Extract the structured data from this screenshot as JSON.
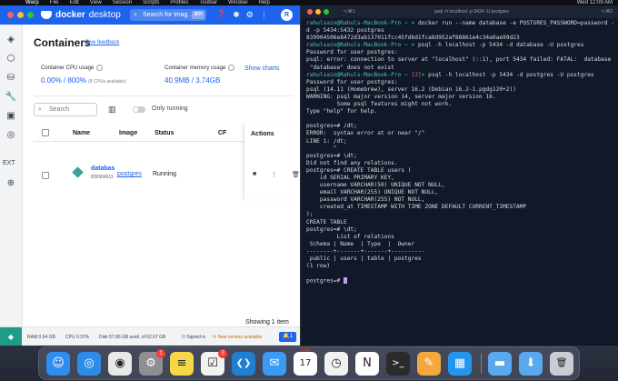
{
  "menubar": {
    "apple": "",
    "items": [
      "Warp",
      "File",
      "Edit",
      "View",
      "Session",
      "Scripts",
      "Profiles",
      "Toolbar",
      "Window",
      "Help"
    ],
    "time": "Wed 12:09 AM"
  },
  "docker": {
    "brand_bold": "docker",
    "brand_light": "desktop",
    "search_placeholder": "Search for imag...",
    "search_shortcut": "⌘K",
    "avatar_initial": "R",
    "page_title": "Containers",
    "feedback_link": "Give feedback",
    "cpu_label": "Container CPU usage",
    "cpu_value": "0.00% / 800%",
    "cpu_sub": "(8 CPUs available)",
    "mem_label": "Container memory usage",
    "mem_value": "40.9MB / 3.74GB",
    "show_charts": "Show charts",
    "search_input_placeholder": "Search",
    "only_running": "Only running",
    "columns": {
      "name": "Name",
      "image": "Image",
      "status": "Status",
      "cpu": "CF",
      "actions": "Actions"
    },
    "rows": [
      {
        "name": "databas",
        "id": "839904511",
        "image": "postgres",
        "status": "Running"
      }
    ],
    "showing": "Showing 1 item",
    "sidebar_ext": "EXT",
    "status_bar": {
      "ram": "RAM 0.94 GB",
      "cpu": "CPU 0.37%",
      "disk": "Disk 57.86 GB avail. of 62.67 GB",
      "signed_in": "Signed in",
      "new_version": "New version available",
      "notifications": "1"
    }
  },
  "terminal": {
    "title": "psql -h localhost -p 5434 -U postgres",
    "shortcut_left": "⌥⌘1",
    "shortcut_right": "⌥⌘2",
    "lines": [
      "rahulsain@Rahuls-MacBook-Pro ~ > docker run --name database -e POSTGRES_PASSWORD=password -",
      "d -p 5434:5432 postgres",
      "839904506e8472d3ab137011fcc45fd6d1fca8d952af88861e4c34a0ae99d23",
      "rahulsain@Rahuls-MacBook-Pro ~ > psql -h localhost -p 5434 -d database -U postgres",
      "Password for user postgres:",
      "psql: error: connection to server at \"localhost\" (::1), port 5434 failed: FATAL:  database",
      " \"database\" does not exist",
      "rahulsain@Rahuls-MacBook-Pro ~ [2]> psql -h localhost -p 5434 -d postgres -U postgres",
      "Password for user postgres:",
      "psql (14.11 (Homebrew), server 16.2 (Debian 16.2-1.pgdg120+2))",
      "WARNING: psql major version 14, server major version 16.",
      "         Some psql features might not work.",
      "Type \"help\" for help.",
      "",
      "postgres=# /dt;",
      "ERROR:  syntax error at or near \"/\"",
      "LINE 1: /dt;",
      "        ^",
      "postgres=# \\dt;",
      "Did not find any relations.",
      "postgres=# CREATE TABLE users (",
      "    id SERIAL PRIMARY KEY,",
      "    username VARCHAR(50) UNIQUE NOT NULL,",
      "    email VARCHAR(255) UNIQUE NOT NULL,",
      "    password VARCHAR(255) NOT NULL,",
      "    created_at TIMESTAMP WITH TIME ZONE DEFAULT CURRENT_TIMESTAMP",
      ");",
      "CREATE TABLE",
      "postgres=# \\dt;",
      "         List of relations",
      " Schema | Name  | Type  |  Owner",
      "--------+-------+-------+----------",
      " public | users | table | postgres",
      "(1 row)",
      "",
      "postgres=# "
    ]
  },
  "dock": {
    "items": [
      {
        "icon": "finder-icon",
        "glyph": "☺",
        "color": "#2f8cf0"
      },
      {
        "icon": "safari-icon",
        "glyph": "◎",
        "color": "#2b8de8"
      },
      {
        "icon": "chrome-icon",
        "glyph": "◉",
        "color": "#e8e8e8"
      },
      {
        "icon": "system-settings-icon",
        "glyph": "⚙",
        "color": "#8e8e93",
        "badge": "1"
      },
      {
        "icon": "notes-icon",
        "glyph": "≡",
        "color": "#f7d64a"
      },
      {
        "icon": "reminders-icon",
        "glyph": "☑",
        "color": "#f2f2f2",
        "badge": "3"
      },
      {
        "icon": "vscode-icon",
        "glyph": "❮❯",
        "color": "#1f7fd1"
      },
      {
        "icon": "mail-icon",
        "glyph": "✉",
        "color": "#3a9bf6"
      },
      {
        "icon": "calendar-icon",
        "glyph": "17",
        "color": "#ffffff",
        "label": "APR"
      },
      {
        "icon": "clock-icon",
        "glyph": "◷",
        "color": "#f2f2f2"
      },
      {
        "icon": "notion-icon",
        "glyph": "N",
        "color": "#ffffff"
      },
      {
        "icon": "terminal-icon",
        "glyph": ">_",
        "color": "#2b2b2b"
      },
      {
        "icon": "pages-icon",
        "glyph": "✎",
        "color": "#f4a73a"
      },
      {
        "icon": "docker-icon",
        "glyph": "▦",
        "color": "#2496ed"
      },
      {
        "icon": "folder-icon",
        "glyph": "▬",
        "color": "#5aa9ef"
      },
      {
        "icon": "downloads-folder-icon",
        "glyph": "⬇",
        "color": "#5aa9ef"
      },
      {
        "icon": "trash-icon",
        "glyph": "🗑",
        "color": "#c9ccd3"
      }
    ]
  }
}
